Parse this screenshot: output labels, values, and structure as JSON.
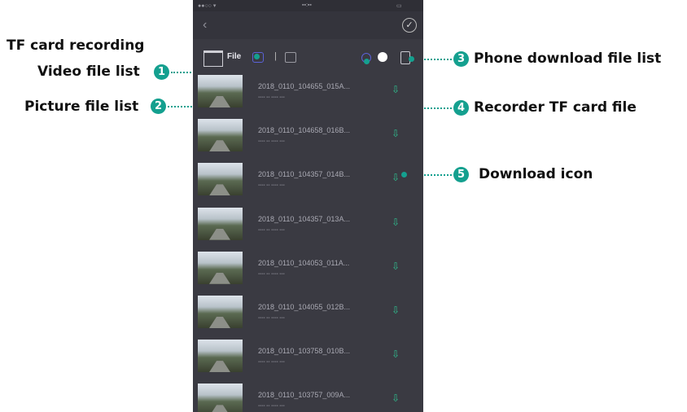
{
  "callouts": {
    "tf_card_recording": "TF card recording",
    "video_file_list": "Video file list",
    "picture_file_list": "Picture file list",
    "phone_download_file_list": "Phone download file list",
    "recorder_tf_card_file": "Recorder TF card file",
    "download_icon": "Download icon",
    "badges": [
      "1",
      "2",
      "3",
      "4",
      "5"
    ]
  },
  "phone": {
    "navbar": {
      "back_icon": "chevron-left-icon",
      "confirm_icon": "check-circle-icon"
    },
    "toolbar": {
      "file_label": "File"
    },
    "files": [
      {
        "name": "2018_0110_104655_015A..."
      },
      {
        "name": "2018_0110_104658_016B..."
      },
      {
        "name": "2018_0110_104357_014B..."
      },
      {
        "name": "2018_0110_104357_013A..."
      },
      {
        "name": "2018_0110_104053_011A..."
      },
      {
        "name": "2018_0110_104055_012B..."
      },
      {
        "name": "2018_0110_103758_010B..."
      },
      {
        "name": "2018_0110_103757_009A..."
      }
    ]
  },
  "colors": {
    "accent": "#14a08f",
    "phone_bg": "#3a3a42",
    "download_icon": "#2fbf8f",
    "tab_active": "#5b62d8"
  }
}
